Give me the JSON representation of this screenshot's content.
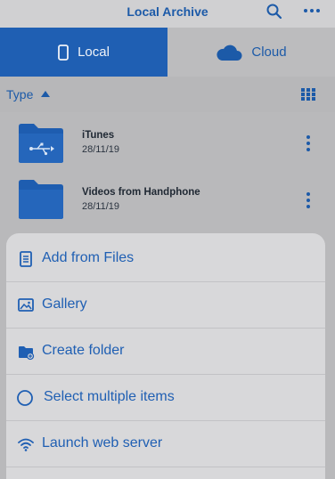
{
  "header": {
    "title": "Local Archive",
    "search_icon": "search-icon",
    "more_icon": "more-horizontal-icon"
  },
  "tabs": [
    {
      "label": "Local",
      "icon": "phone-icon",
      "selected": true
    },
    {
      "label": "Cloud",
      "icon": "cloud-icon",
      "selected": false
    }
  ],
  "sort": {
    "label": "Type",
    "direction_icon": "triangle-up-icon",
    "view_icon": "grid-icon"
  },
  "files": [
    {
      "name": "iTunes",
      "date": "28/11/19",
      "icon": "usb-folder-icon"
    },
    {
      "name": "Videos from Handphone",
      "date": "28/11/19",
      "icon": "folder-icon"
    }
  ],
  "actions": [
    {
      "label": "Add from Files",
      "icon": "document-icon"
    },
    {
      "label": "Gallery",
      "icon": "gallery-icon"
    },
    {
      "label": "Create folder",
      "icon": "folder-plus-icon"
    },
    {
      "label": "Select multiple items",
      "icon": "circle-icon"
    },
    {
      "label": "Launch web server",
      "icon": "wifi-icon"
    }
  ],
  "colors": {
    "accent": "#1f5fb3",
    "tab_active_bg": "#1f5fb3",
    "sheet_bg": "#d8d8da",
    "dim_bg": "#b9b9bb"
  }
}
